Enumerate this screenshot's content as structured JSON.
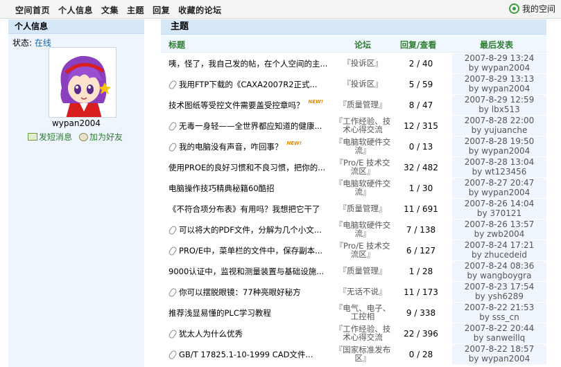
{
  "nav": {
    "items": [
      "空间首页",
      "个人信息",
      "文集",
      "主题",
      "回复",
      "收藏的论坛"
    ],
    "myspace": "我的空间"
  },
  "profile": {
    "header": "个人信息",
    "status_label": "状态:",
    "status_value": "在线",
    "username": "wypan2004",
    "send_message": "发短消息",
    "add_friend": "加为好友"
  },
  "topics": {
    "header": "主题",
    "columns": {
      "title": "标题",
      "forum": "论坛",
      "reply": "回复/查看",
      "last": "最后发表"
    },
    "rows": [
      {
        "title": "咦，怪了，我自己发的帖，在个人空间的主...",
        "attach": false,
        "new": false,
        "forum": "『投诉区』",
        "reply": "2 / 40",
        "date": "2007-8-29 13:24",
        "by": "by wypan2004"
      },
      {
        "title": "我用FTP下载的《CAXA2007R2正式...",
        "attach": true,
        "new": false,
        "forum": "『投诉区』",
        "reply": "5 / 59",
        "date": "2007-8-29 13:13",
        "by": "by wypan2004"
      },
      {
        "title": "技术图纸等受控文件需要盖受控章吗？",
        "attach": false,
        "new": true,
        "forum": "『质量管理』",
        "reply": "8 / 47",
        "date": "2007-8-29 12:59",
        "by": "by lbx513"
      },
      {
        "title": "无毒一身轻——全世界都应知道的健康...",
        "attach": true,
        "new": false,
        "forum": "『工作经验、技术心得交流",
        "reply": "12 / 315",
        "date": "2007-8-28 22:00",
        "by": "by yujuanche"
      },
      {
        "title": "我的电脑没有声音，咋回事？",
        "attach": true,
        "new": true,
        "forum": "『电脑软硬件交流』",
        "reply": "0 / 13",
        "date": "2007-8-28 19:50",
        "by": "by wypan2004"
      },
      {
        "title": "使用PROE的良好习惯和不良习惯，把你的...",
        "attach": false,
        "new": false,
        "forum": "『Pro/E 技术交流区』",
        "reply": "32 / 482",
        "date": "2007-8-28 13:04",
        "by": "by wt123456"
      },
      {
        "title": "电脑操作技巧精典秘籍60酷招",
        "attach": false,
        "new": false,
        "forum": "『电脑软硬件交流』",
        "reply": "1 / 30",
        "date": "2007-8-27 20:47",
        "by": "by wypan2004"
      },
      {
        "title": "《不符合项分布表》有用吗？我想把它干了",
        "attach": false,
        "new": false,
        "forum": "『质量管理』",
        "reply": "11 / 691",
        "date": "2007-8-26 14:04",
        "by": "by 370121"
      },
      {
        "title": "可以将大的PDF文件，分解为几个小文...",
        "attach": true,
        "new": false,
        "forum": "『电脑软硬件交流』",
        "reply": "7 / 138",
        "date": "2007-8-26 13:57",
        "by": "by zwb2004"
      },
      {
        "title": "PRO/E中，菜单栏的文件中，保存副本...",
        "attach": true,
        "new": false,
        "forum": "『Pro/E 技术交流区』",
        "reply": "6 / 127",
        "date": "2007-8-24 17:21",
        "by": "by zhucedeid"
      },
      {
        "title": "9000认证中，监视和测量装置与基础设施...",
        "attach": false,
        "new": false,
        "forum": "『质量管理』",
        "reply": "1 / 28",
        "date": "2007-8-24 08:36",
        "by": "by wangboygra"
      },
      {
        "title": "你可以摆脱眼镜：77种亮眼好秘方",
        "attach": true,
        "new": false,
        "forum": "『无话不说』",
        "reply": "11 / 173",
        "date": "2007-8-23 17:54",
        "by": "by ysh6289"
      },
      {
        "title": "推荐浅显易懂的PLC学习教程",
        "attach": false,
        "new": false,
        "forum": "『电气、电子、工控相",
        "reply": "9 / 338",
        "date": "2007-8-22 21:53",
        "by": "by sss_cn"
      },
      {
        "title": "犹太人为什么优秀",
        "attach": true,
        "new": false,
        "forum": "『工作经验、技术心得交流",
        "reply": "22 / 396",
        "date": "2007-8-22 20:44",
        "by": "by sanweillq"
      },
      {
        "title": "GB/T 17825.1-10-1999 CAD文件...",
        "attach": true,
        "new": false,
        "forum": "『国家标准发布区』",
        "reply": "0 / 28",
        "date": "2007-8-22 18:57",
        "by": "by wypan2004"
      }
    ]
  },
  "colors": {
    "header_bg": "#d6e8f8",
    "panel_bg": "#eef5fc",
    "col_head_text": "#2e7d32",
    "link": "#1565b8"
  },
  "icons": [
    "gear-icon",
    "avatar-image",
    "message-icon",
    "friend-icon",
    "attachment-icon",
    "new-badge"
  ]
}
